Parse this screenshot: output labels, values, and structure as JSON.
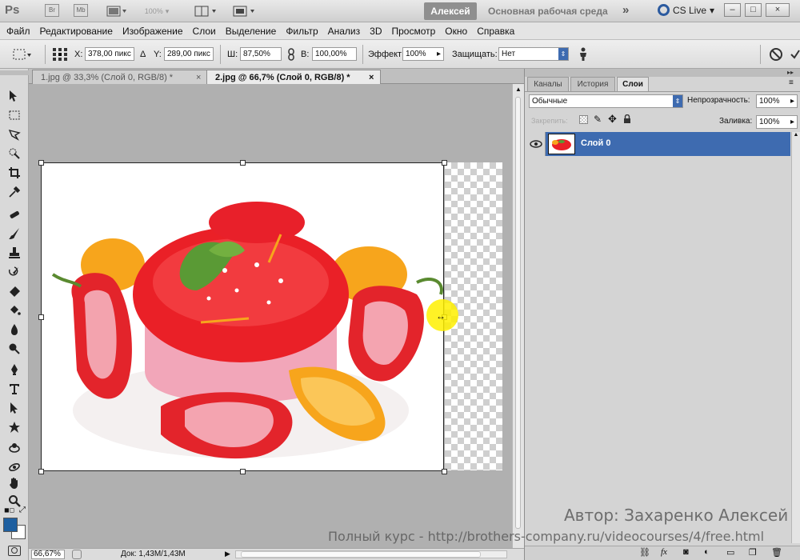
{
  "appbar": {
    "logo": "Ps",
    "br_label": "Br",
    "mb_label": "Mb",
    "zoom_label": "100%",
    "user": "Алексей",
    "workspace": "Основная рабочая среда",
    "overflow": "»",
    "cslive": "CS Live",
    "win_min": "–",
    "win_max": "□",
    "win_close": "×"
  },
  "menu": [
    "Файл",
    "Редактирование",
    "Изображение",
    "Слои",
    "Выделение",
    "Фильтр",
    "Анализ",
    "3D",
    "Просмотр",
    "Окно",
    "Справка"
  ],
  "options": {
    "x_label": "X:",
    "x_value": "378,00 пикс",
    "delta_label": "Δ",
    "y_label": "Y:",
    "y_value": "289,00 пикс",
    "w_label": "Ш:",
    "w_value": "87,50%",
    "h_label": "В:",
    "h_value": "100,00%",
    "effect_label": "Эффект",
    "effect_value": "100%",
    "protect_label": "Защищать:",
    "protect_value": "Нет"
  },
  "tabs": [
    {
      "label": "1.jpg @ 33,3% (Слой 0, RGB/8) *",
      "close": "×"
    },
    {
      "label": "2.jpg @ 66,7% (Слой 0, RGB/8) *",
      "close": "×"
    }
  ],
  "status": {
    "zoom": "66,67%",
    "doc": "Док: 1,43M/1,43M"
  },
  "panel": {
    "tabs": [
      "Каналы",
      "История",
      "Слои"
    ],
    "blend_mode": "Обычные",
    "opacity_label": "Непрозрачность:",
    "opacity_value": "100%",
    "lock_label": "Закрепить:",
    "fill_label": "Заливка:",
    "fill_value": "100%",
    "layer_name": "Слой 0"
  },
  "watermark": {
    "author": "Автор: Захаренко Алексей",
    "course": "Полный курс - http://brothers-company.ru/videocourses/4/free.html"
  },
  "colors": {
    "accent": "#3e6bb0",
    "foreground": "#1e5fa0",
    "background": "#ffffff"
  }
}
